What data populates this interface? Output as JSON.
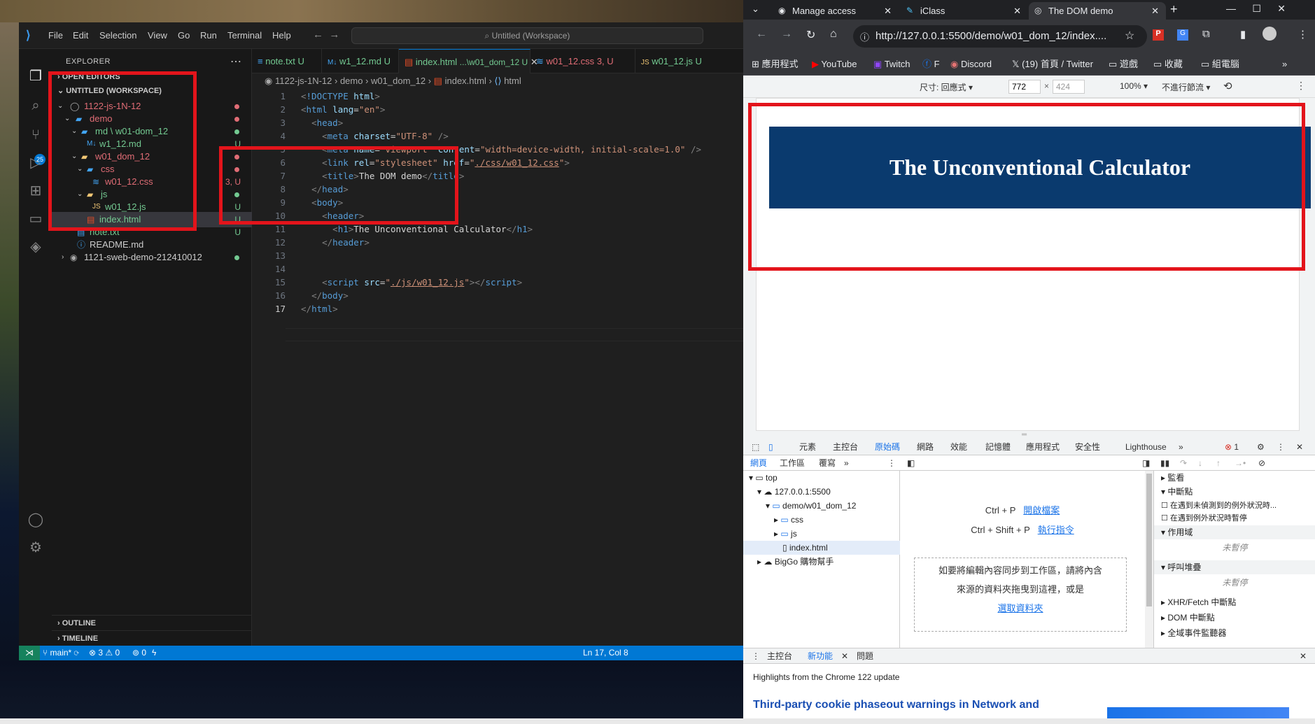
{
  "vscode": {
    "menu": [
      "File",
      "Edit",
      "Selection",
      "View",
      "Go",
      "Run",
      "Terminal",
      "Help"
    ],
    "command_center": "Untitled (Workspace)",
    "source_control_badge": "25",
    "explorer_title": "EXPLORER",
    "open_editors": "OPEN EDITORS",
    "workspace": "UNTITLED (WORKSPACE)",
    "tree": [
      {
        "label": "1122-js-1N-12",
        "color": "#e06c75",
        "badge": "dot"
      },
      {
        "label": "demo",
        "color": "#e06c75",
        "badge": "dot"
      },
      {
        "label": "md \\ w01-dom_12",
        "color": "#73c991",
        "badge": "dot"
      },
      {
        "label": "w1_12.md",
        "color": "#73c991",
        "badge": "U"
      },
      {
        "label": "w01_dom_12",
        "color": "#e06c75",
        "badge": "dot"
      },
      {
        "label": "css",
        "color": "#e06c75",
        "badge": "dot"
      },
      {
        "label": "w01_12.css",
        "color": "#e06c75",
        "badge": "3, U"
      },
      {
        "label": "js",
        "color": "#73c991",
        "badge": "dot"
      },
      {
        "label": "w01_12.js",
        "color": "#73c991",
        "badge": "U"
      },
      {
        "label": "index.html",
        "color": "#73c991",
        "badge": "U"
      },
      {
        "label": "note.txt",
        "color": "#73c991",
        "badge": "U"
      },
      {
        "label": "README.md",
        "color": "#cccccc",
        "badge": ""
      },
      {
        "label": "1121-sweb-demo-212410012",
        "color": "#cccccc",
        "badge": "dot"
      }
    ],
    "outline": "OUTLINE",
    "timeline": "TIMELINE",
    "tabs": [
      {
        "label": "note.txt",
        "suffix": "U",
        "color": "#73c991"
      },
      {
        "label": "w1_12.md",
        "suffix": "U",
        "color": "#73c991"
      },
      {
        "label": "index.html",
        "suffix": "...\\w01_dom_12  U",
        "color": "#73c991"
      },
      {
        "label": "w01_12.css",
        "suffix": "3, U",
        "color": "#e06c75"
      },
      {
        "label": "w01_12.js",
        "suffix": "U",
        "color": "#73c991"
      }
    ],
    "breadcrumb": [
      "1122-js-1N-12",
      "demo",
      "w01_dom_12",
      "index.html",
      "html"
    ],
    "status": {
      "branch": "main*",
      "errors": "3",
      "warnings": "0",
      "ports": "0",
      "position": "Ln 17, Col 8"
    }
  },
  "browser": {
    "tabs": [
      "Manage access",
      "iClass",
      "The DOM demo"
    ],
    "url": "http://127.0.0.1:5500/demo/w01_dom_12/index....",
    "bookmarks": [
      "應用程式",
      "YouTube",
      "Twitch",
      "F",
      "Discord",
      "(19) 首頁 / Twitter",
      "遊戲",
      "收藏",
      "組電腦"
    ],
    "device": {
      "size_label": "尺寸: 回應式",
      "width": "772",
      "height": "424",
      "zoom": "100%",
      "throttle": "不進行節流"
    },
    "page_title": "The Unconventional Calculator",
    "devtools_tabs": [
      "元素",
      "主控台",
      "原始碼",
      "網路",
      "效能",
      "記憶體",
      "應用程式",
      "安全性",
      "Lighthouse"
    ],
    "error_count": "1",
    "sources_subtabs": [
      "網頁",
      "工作區",
      "覆寫"
    ],
    "sources_tree": [
      "top",
      "127.0.0.1:5500",
      "demo/w01_dom_12",
      "css",
      "js",
      "index.html",
      "BigGo 購物幫手"
    ],
    "shortcut1_key": "Ctrl + P",
    "shortcut1_action": "開啟檔案",
    "shortcut2_key": "Ctrl + Shift + P",
    "shortcut2_action": "執行指令",
    "drop_line1": "如要將編輯內容同步到工作區，請將內含",
    "drop_line2": "來源的資料夾拖曳到這裡，或是",
    "drop_link": "選取資料夾",
    "right_panel": [
      "監看",
      "中斷點",
      "在遇到未偵測到的例外狀況時...",
      "在遇到例外狀況時暫停",
      "作用域",
      "未暫停",
      "呼叫堆疊",
      "未暫停",
      "XHR/Fetch 中斷點",
      "DOM 中斷點",
      "全域事件監聽器"
    ],
    "drawer_tabs": [
      "主控台",
      "新功能",
      "問題"
    ],
    "whatsnew": "Highlights from the Chrome 122 update",
    "feature_title": "Third-party cookie phaseout warnings in Network and"
  }
}
